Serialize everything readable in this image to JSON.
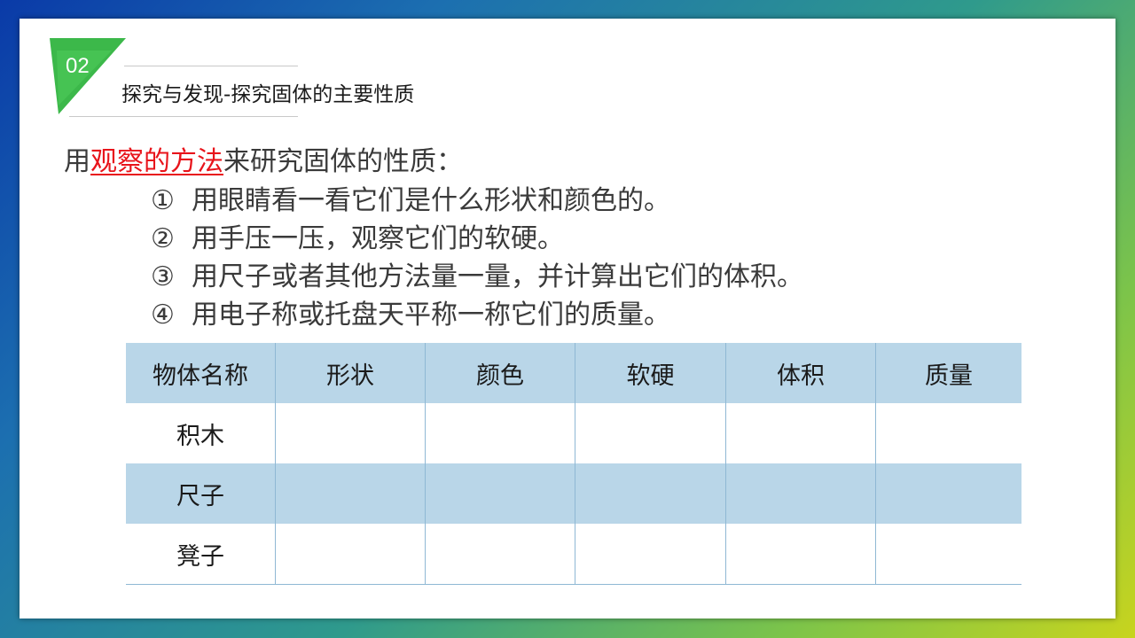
{
  "section": {
    "number": "02",
    "title": "探究与发现-探究固体的主要性质"
  },
  "intro": {
    "prefix": "用",
    "highlight": "观察的方法",
    "suffix": "来研究固体的性质："
  },
  "steps": [
    {
      "num": "①",
      "text": "用眼睛看一看它们是什么形状和颜色的。"
    },
    {
      "num": "②",
      "text": "用手压一压，观察它们的软硬。"
    },
    {
      "num": "③",
      "text": "用尺子或者其他方法量一量，并计算出它们的体积。"
    },
    {
      "num": "④",
      "text": "用电子称或托盘天平称一称它们的质量。"
    }
  ],
  "table": {
    "headers": [
      "物体名称",
      "形状",
      "颜色",
      "软硬",
      "体积",
      "质量"
    ],
    "rows": [
      {
        "name": "积木"
      },
      {
        "name": "尺子"
      },
      {
        "name": "凳子"
      }
    ]
  },
  "colors": {
    "accent_green": "#3cb84a",
    "highlight_red": "#e8141b",
    "table_shade": "#b9d6e8"
  }
}
